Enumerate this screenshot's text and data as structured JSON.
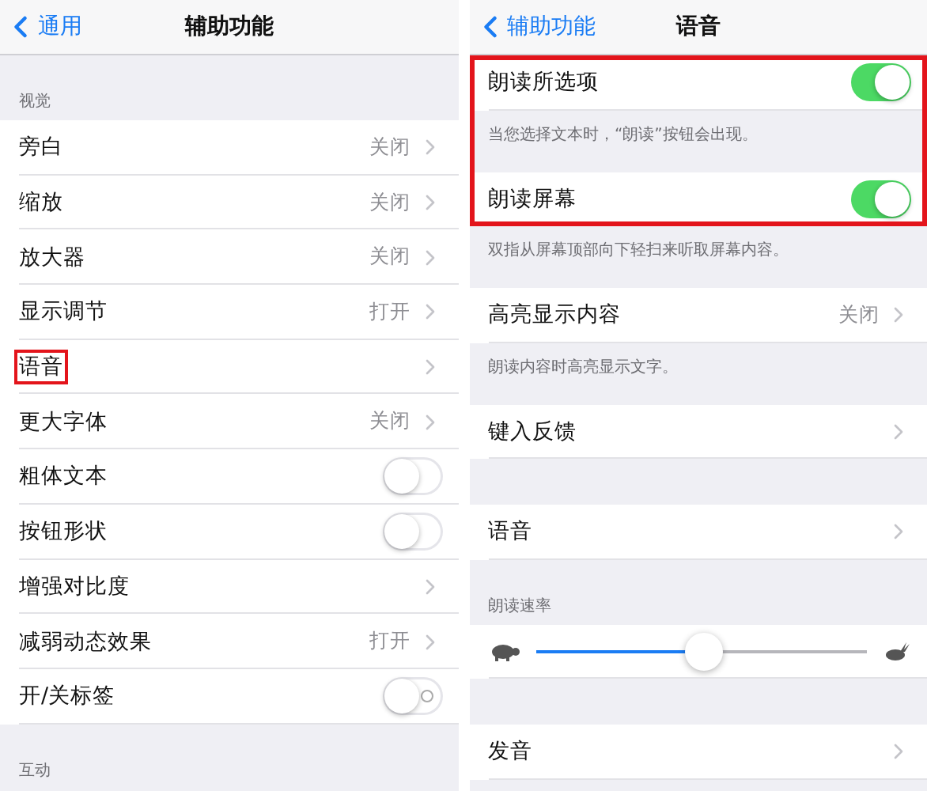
{
  "panels": [
    {
      "nav": {
        "back": "通用",
        "title": "辅助功能"
      },
      "blocks": [
        {
          "kind": "header",
          "text": "视觉"
        },
        {
          "kind": "link_row",
          "label": "旁白",
          "value": "关闭",
          "highlighted": false
        },
        {
          "kind": "link_row",
          "label": "缩放",
          "value": "关闭",
          "highlighted": false
        },
        {
          "kind": "link_row",
          "label": "放大器",
          "value": "关闭",
          "highlighted": false
        },
        {
          "kind": "link_row",
          "label": "显示调节",
          "value": "打开",
          "highlighted": false
        },
        {
          "kind": "link_row",
          "label": "语音",
          "highlighted": true
        },
        {
          "kind": "link_row",
          "label": "更大字体",
          "value": "关闭",
          "highlighted": false
        },
        {
          "kind": "toggle_row",
          "label": "粗体文本",
          "on": false,
          "highlighted": false
        },
        {
          "kind": "toggle_row",
          "label": "按钮形状",
          "on": false,
          "highlighted": false
        },
        {
          "kind": "link_row",
          "label": "增强对比度",
          "highlighted": false
        },
        {
          "kind": "link_row",
          "label": "减弱动态效果",
          "value": "打开",
          "highlighted": false
        },
        {
          "kind": "toggle_row",
          "label": "开/关标签",
          "on": false,
          "on_off_labels": true,
          "highlighted": false
        },
        {
          "kind": "header",
          "text": "互动"
        }
      ]
    },
    {
      "nav": {
        "back": "辅助功能",
        "title": "语音"
      },
      "blocks": [
        {
          "kind": "toggle_row",
          "label": "朗读所选项",
          "on": true,
          "highlighted": true
        },
        {
          "kind": "footer",
          "text": "当您选择文本时，“朗读”按钮会出现。",
          "highlighted": true
        },
        {
          "kind": "toggle_row",
          "label": "朗读屏幕",
          "on": true,
          "highlighted": true
        },
        {
          "kind": "footer",
          "text": "双指从屏幕顶部向下轻扫来听取屏幕内容。"
        },
        {
          "kind": "link_row",
          "label": "高亮显示内容",
          "value": "关闭"
        },
        {
          "kind": "footer",
          "text": "朗读内容时高亮显示文字。"
        },
        {
          "kind": "link_row",
          "label": "键入反馈"
        },
        {
          "kind": "spacer"
        },
        {
          "kind": "link_row",
          "label": "语音"
        },
        {
          "kind": "header",
          "text": "朗读速率"
        },
        {
          "kind": "slider",
          "level": 0.51
        },
        {
          "kind": "spacer"
        },
        {
          "kind": "link_row",
          "label": "发音"
        }
      ]
    }
  ]
}
